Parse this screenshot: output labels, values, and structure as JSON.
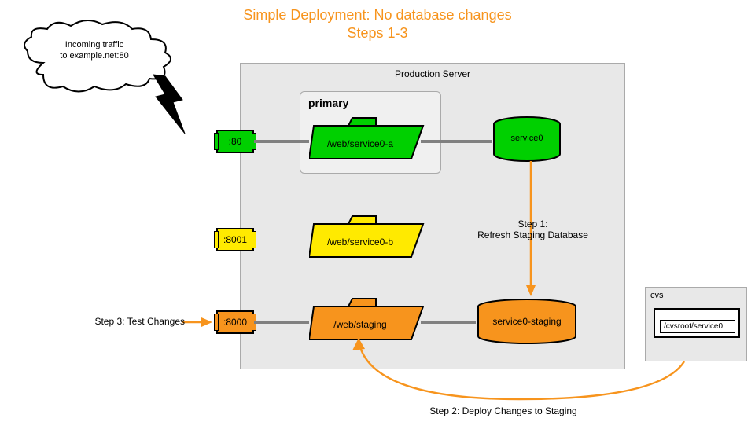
{
  "title_line1": "Simple Deployment: No database changes",
  "title_line2": "Steps 1-3",
  "cloud": {
    "line1": "Incoming traffic",
    "line2": "to example.net:80"
  },
  "production_server": "Production Server",
  "primary": "primary",
  "ports": {
    "p80": ":80",
    "p8001": ":8001",
    "p8000": ":8000"
  },
  "folders": {
    "a": "/web/service0-a",
    "b": "/web/service0-b",
    "staging": "/web/staging"
  },
  "db": {
    "main": "service0",
    "staging": "service0-staging"
  },
  "cvs": {
    "title": "cvs",
    "path": "/cvsroot/service0"
  },
  "steps": {
    "s1_l1": "Step 1:",
    "s1_l2": "Refresh Staging Database",
    "s2": "Step 2: Deploy Changes to Staging",
    "s3": "Step 3: Test Changes"
  },
  "colors": {
    "green": "#00d000",
    "yellow": "#ffea00",
    "orange": "#f7941d",
    "grey": "#808080"
  }
}
